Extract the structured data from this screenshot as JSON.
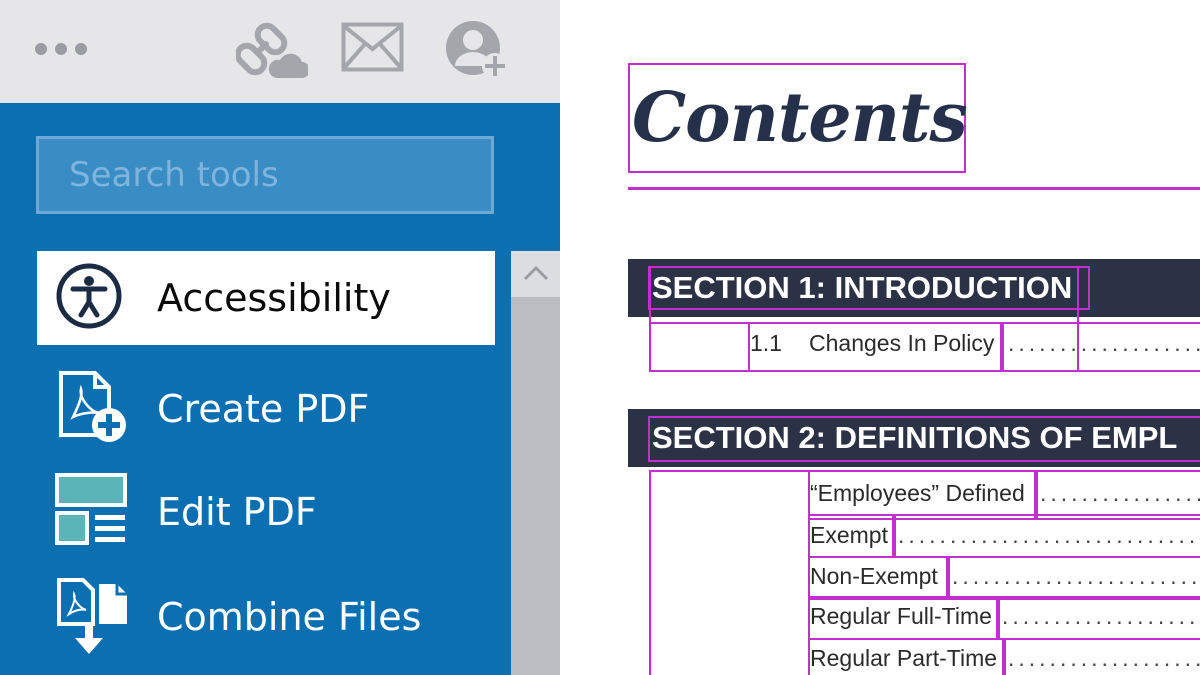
{
  "toolbar": {
    "more_icon": "more-horizontal-icon",
    "share_link_icon": "cloud-link-icon",
    "email_icon": "envelope-icon",
    "add_user_icon": "add-user-icon"
  },
  "tools_panel": {
    "search": {
      "placeholder": "Search tools",
      "value": ""
    },
    "items": [
      {
        "label": "Accessibility",
        "icon": "accessibility-icon",
        "selected": true
      },
      {
        "label": "Create PDF",
        "icon": "create-pdf-icon",
        "selected": false
      },
      {
        "label": "Edit PDF",
        "icon": "edit-pdf-icon",
        "selected": false
      },
      {
        "label": "Combine Files",
        "icon": "combine-files-icon",
        "selected": false
      }
    ]
  },
  "document": {
    "title": "Contents",
    "sections": [
      {
        "heading": "SECTION 1: INTRODUCTION",
        "entries": [
          {
            "number": "1.1",
            "label": "Changes In Policy"
          }
        ]
      },
      {
        "heading": "SECTION 2: DEFINITIONS OF EMPL",
        "entries": [
          {
            "label": "“Employees” Defined"
          },
          {
            "label": "Exempt"
          },
          {
            "label": "Non-Exempt"
          },
          {
            "label": "Regular Full-Time"
          },
          {
            "label": "Regular Part-Time"
          }
        ]
      }
    ],
    "leader": "..............................",
    "colors": {
      "tag_outline": "#c32fcf",
      "section_bar": "#2b3245",
      "title": "#25304a"
    }
  },
  "colors": {
    "panel_blue": "#0b6fb2",
    "toolbar_gray": "#e6e6e9",
    "icon_navy": "#1c2b44",
    "icon_teal": "#5bb5b8"
  }
}
